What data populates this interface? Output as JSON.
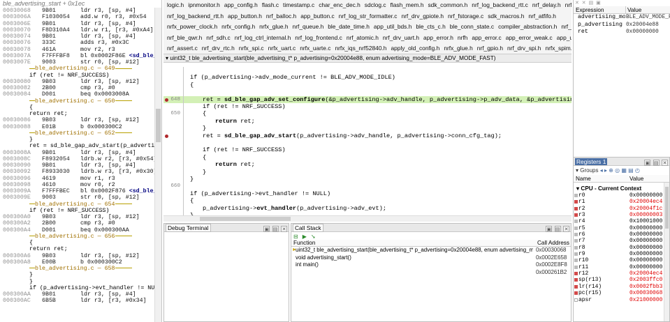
{
  "disassembly": {
    "header": "ble_advertising_start + 0x1ec",
    "lines": [
      {
        "kind": "asm",
        "addr": "00030068",
        "op": "9B01",
        "ins": "ldr r3, [sp, #4]"
      },
      {
        "kind": "asm",
        "addr": "0003006A",
        "op": "F1030054",
        "ins": "add.w r0, r3, #0x54"
      },
      {
        "kind": "asm",
        "addr": "0003006E",
        "op": "9B01",
        "ins": "ldr r3, [sp, #4]"
      },
      {
        "kind": "asm",
        "addr": "00030070",
        "op": "F8D310A4",
        "ins": "ldr.w r1, [r3, #0xA4]"
      },
      {
        "kind": "asm",
        "addr": "00030074",
        "op": "9B01",
        "ins": "ldr r3, [sp, #4]"
      },
      {
        "kind": "asm",
        "addr": "00030076",
        "op": "333C",
        "ins": "adds r3, #0x3C"
      },
      {
        "kind": "asm",
        "addr": "00030078",
        "op": "461A",
        "ins": "mov r2, r3"
      },
      {
        "kind": "asm",
        "addr": "0003007A",
        "op": "F7FFFBF8",
        "ins": "bl 0x0002F86E ",
        "sym": "<sd_ble_gap"
      },
      {
        "kind": "asm",
        "addr": "0003007E",
        "op": "9003",
        "ins": "str r0, [sp, #12]"
      },
      {
        "kind": "hdr",
        "text": "ble_advertising.c — 649"
      },
      {
        "kind": "src",
        "text": "if (ret != NRF_SUCCESS)"
      },
      {
        "kind": "asm",
        "addr": "00030080",
        "op": "9B03",
        "ins": "ldr r3, [sp, #12]"
      },
      {
        "kind": "asm",
        "addr": "00030082",
        "op": "2B00",
        "ins": "cmp r3, #0"
      },
      {
        "kind": "asm",
        "addr": "00030084",
        "op": "D001",
        "ins": "beq 0x0003008A"
      },
      {
        "kind": "hdr",
        "text": "ble_advertising.c — 650"
      },
      {
        "kind": "src",
        "text": "{"
      },
      {
        "kind": "src",
        "text": "return ret;"
      },
      {
        "kind": "asm",
        "addr": "00030086",
        "op": "9B03",
        "ins": "ldr r3, [sp, #12]"
      },
      {
        "kind": "asm",
        "addr": "00030088",
        "op": "E01B",
        "ins": "b 0x000300C2"
      },
      {
        "kind": "hdr",
        "text": "ble_advertising.c — 652"
      },
      {
        "kind": "src",
        "text": "}"
      },
      {
        "kind": "src",
        "text": "ret = sd_ble_gap_adv_start(p_advertising"
      },
      {
        "kind": "asm",
        "addr": "0003008A",
        "op": "9B01",
        "ins": "ldr r3, [sp, #4]"
      },
      {
        "kind": "asm",
        "addr": "0003008C",
        "op": "F8932054",
        "ins": "ldrb.w r2, [r3, #0x54]"
      },
      {
        "kind": "asm",
        "addr": "00030090",
        "op": "9B01",
        "ins": "ldr r3, [sp, #4]"
      },
      {
        "kind": "asm",
        "addr": "00030092",
        "op": "F8933030",
        "ins": "ldrb.w r3, [r3, #0x30]"
      },
      {
        "kind": "asm",
        "addr": "00030096",
        "op": "4619",
        "ins": "mov r1, r3"
      },
      {
        "kind": "asm",
        "addr": "00030098",
        "op": "4610",
        "ins": "mov r0, r2"
      },
      {
        "kind": "asm",
        "addr": "0003009A",
        "op": "F7FFFBEC",
        "ins": "bl 0x0002F876 ",
        "sym": "<sd_ble_ga"
      },
      {
        "kind": "asm",
        "addr": "0003009E",
        "op": "9003",
        "ins": "str r0, [sp, #12]"
      },
      {
        "kind": "hdr",
        "text": "ble_advertising.c — 654"
      },
      {
        "kind": "src",
        "text": "if (ret != NRF_SUCCESS)"
      },
      {
        "kind": "asm",
        "addr": "000300A0",
        "op": "9B03",
        "ins": "ldr r3, [sp, #12]"
      },
      {
        "kind": "asm",
        "addr": "000300A2",
        "op": "2B00",
        "ins": "cmp r3, #0"
      },
      {
        "kind": "asm",
        "addr": "000300A4",
        "op": "D001",
        "ins": "beq 0x000300AA"
      },
      {
        "kind": "hdr",
        "text": "ble_advertising.c — 656"
      },
      {
        "kind": "src",
        "text": "{"
      },
      {
        "kind": "src",
        "text": "return ret;"
      },
      {
        "kind": "asm",
        "addr": "000300A6",
        "op": "9B03",
        "ins": "ldr r3, [sp, #12]"
      },
      {
        "kind": "asm",
        "addr": "000300A8",
        "op": "E00B",
        "ins": "b 0x000300C2"
      },
      {
        "kind": "hdr",
        "text": "ble_advertising.c — 658"
      },
      {
        "kind": "src",
        "text": "}"
      },
      {
        "kind": "src",
        "text": "}"
      },
      {
        "kind": "src",
        "text": "if (p_advertising->evt_handler != NULL)"
      },
      {
        "kind": "asm",
        "addr": "000300AA",
        "op": "9B01",
        "ins": "ldr r3, [sp, #4]"
      },
      {
        "kind": "asm",
        "addr": "000300AC",
        "op": "6B5B",
        "ins": "ldr r3, [r3, #0x34]"
      }
    ]
  },
  "tabs": {
    "rows": [
      [
        "logic.h",
        "ipnmonitor.h",
        "app_config.h",
        "flash.c",
        "timestamp.c",
        "char_enc_dec.h",
        "sdclog.c",
        "flash_mem.h",
        "sdk_common.h",
        "nrf_log_backend_rtt.c",
        "nrf_delay.h",
        "nrfx.h"
      ],
      [
        "nrf_log_backend_rtt.h",
        "app_button.h",
        "nrf_balloc.h",
        "app_button.c",
        "nrf_log_str_formatter.c",
        "nrf_drv_gpiote.h",
        "nrf_fstorage.c",
        "sdk_macros.h",
        "nrf_atfifo.h"
      ],
      [
        "nrfx_power_clock.h",
        "nrfx_config.h",
        "nrfx_glue.h",
        "nrf_queue.h",
        "ble_date_time.h",
        "app_util_bds.h",
        "ble_cts_c.h",
        "ble_conn_state.c",
        "compiler_abstraction.h",
        "nrf_ble_gatt.c"
      ],
      [
        "nrf_ble_qwr.h",
        "nrf_sdh.c",
        "nrf_log_ctrl_internal.h",
        "nrf_log_frontend.c",
        "nrf_atomic.h",
        "nrf_drv_uart.h",
        "app_error.h",
        "nrfh",
        "app_error.c",
        "app_error_weak.c",
        "app_util_platform.c"
      ],
      [
        "nrf_assert.c",
        "nrf_drv_rtc.h",
        "nrfx_spi.c",
        "nrfx_uart.c",
        "nrfx_uarte.c",
        "nrfx_iqs_nrf52840.h",
        "apply_old_config.h",
        "nrfx_glue.h",
        "nrf_gpio.h",
        "nrf_drv_spi.h",
        "nrfx_spim.h",
        "nrfx_spi.h"
      ],
      [
        "nrfx_spim.c",
        "flash_mem.c",
        "timestamp.h",
        "nrf_serial.h",
        "ble_advertising.c",
        "ble_advertising.h",
        "app_error_handler_gcc.c",
        "ble_gap.h"
      ]
    ],
    "active": "ble_advertising.c"
  },
  "editor": {
    "function_signature": "uint32_t ble_advertising_start(ble_advertising_t* p_advertising=0x20004e88, enum advertising_mode=BLE_ADV_MODE_FAST)",
    "lines": [
      {
        "ln": "",
        "bp": false,
        "hl": false,
        "indent": 0,
        "code": ""
      },
      {
        "ln": "",
        "bp": false,
        "hl": false,
        "indent": 0,
        "code": "if (p_advertising->adv_mode_current != BLE_ADV_MODE_IDLE)"
      },
      {
        "ln": "",
        "bp": false,
        "hl": false,
        "indent": 0,
        "code": "{"
      },
      {
        "ln": "",
        "bp": false,
        "hl": false,
        "indent": 0,
        "code": ""
      },
      {
        "ln": "648",
        "bp": true,
        "hl": true,
        "indent": 1,
        "pre": "ret = ",
        "fn": "sd_ble_gap_adv_set_configure",
        "post": "(&p_advertising->adv_handle, p_advertising->p_adv_data, &p_advertising->adv_para"
      },
      {
        "ln": "",
        "bp": false,
        "hl": false,
        "indent": 1,
        "code": "if (ret != NRF_SUCCESS)"
      },
      {
        "ln": "650",
        "bp": false,
        "hl": false,
        "indent": 1,
        "code": "{"
      },
      {
        "ln": "",
        "bp": false,
        "hl": false,
        "indent": 2,
        "pre": "",
        "fn": "return",
        "post": " ret;"
      },
      {
        "ln": "",
        "bp": false,
        "hl": false,
        "indent": 1,
        "code": "}"
      },
      {
        "ln": "",
        "bp": true,
        "hl": false,
        "indent": 1,
        "pre": "ret = ",
        "fn": "sd_ble_gap_adv_start",
        "post": "(p_advertising->adv_handle, p_advertising->conn_cfg_tag);"
      },
      {
        "ln": "",
        "bp": false,
        "hl": false,
        "indent": 0,
        "code": ""
      },
      {
        "ln": "",
        "bp": false,
        "hl": false,
        "indent": 1,
        "code": "if (ret != NRF_SUCCESS)"
      },
      {
        "ln": "",
        "bp": false,
        "hl": false,
        "indent": 1,
        "code": "{"
      },
      {
        "ln": "",
        "bp": false,
        "hl": false,
        "indent": 2,
        "pre": "",
        "fn": "return",
        "post": " ret;"
      },
      {
        "ln": "",
        "bp": false,
        "hl": false,
        "indent": 1,
        "code": "}"
      },
      {
        "ln": "",
        "bp": false,
        "hl": false,
        "indent": 0,
        "code": "}"
      },
      {
        "ln": "660",
        "bp": false,
        "hl": false,
        "indent": 0,
        "code": ""
      },
      {
        "ln": "",
        "bp": false,
        "hl": false,
        "indent": 0,
        "code": "if (p_advertising->evt_handler != NULL)"
      },
      {
        "ln": "",
        "bp": false,
        "hl": false,
        "indent": 0,
        "code": "{"
      },
      {
        "ln": "",
        "bp": false,
        "hl": false,
        "indent": 1,
        "pre": "p_advertising->",
        "fn": "evt_handler",
        "post": "(p_advertising->adv_evt);"
      },
      {
        "ln": "",
        "bp": false,
        "hl": false,
        "indent": 0,
        "code": "}"
      }
    ]
  },
  "debug_terminal": {
    "title": "Debug Terminal"
  },
  "call_stack": {
    "title": "Call Stack",
    "col_function": "Function",
    "col_address": "Call Address",
    "rows": [
      {
        "fn": "uint32_t ble_advertising_start(ble_advertising_t* p_advertising=0x20004e88, enum advertising_mode=BL",
        "addr": "0x00030068",
        "current": true
      },
      {
        "fn": "void advertising_start()",
        "addr": "0x0002E658",
        "current": false
      },
      {
        "fn": "int main()",
        "addr": "0x0002E8F8",
        "current": false
      },
      {
        "fn": "",
        "addr": "0x000261B2",
        "current": false
      }
    ]
  },
  "watch": {
    "col_expression": "Expression",
    "col_value": "Value",
    "rows": [
      {
        "name": "advertising_mode",
        "value": "BLE_ADV_MODE_FAST"
      },
      {
        "name": "p_advertising",
        "value": "0x20004e88"
      },
      {
        "name": "ret",
        "value": "0x00000000"
      }
    ]
  },
  "registers": {
    "title": "Registers 1",
    "groups_label": "Groups",
    "col_name": "Name",
    "col_value": "Value",
    "group": "CPU - Current Context",
    "rows": [
      {
        "name": "r0",
        "value": "0x00000000",
        "changed": false,
        "plus": false
      },
      {
        "name": "r1",
        "value": "0x20004ec4",
        "changed": true,
        "plus": false
      },
      {
        "name": "r2",
        "value": "0x20004f1c",
        "changed": true,
        "plus": false
      },
      {
        "name": "r3",
        "value": "0x00000003",
        "changed": true,
        "plus": false
      },
      {
        "name": "r4",
        "value": "0x10001000",
        "changed": false,
        "plus": false
      },
      {
        "name": "r5",
        "value": "0x00000000",
        "changed": false,
        "plus": false
      },
      {
        "name": "r6",
        "value": "0x00000000",
        "changed": false,
        "plus": false
      },
      {
        "name": "r7",
        "value": "0x00000000",
        "changed": false,
        "plus": false
      },
      {
        "name": "r8",
        "value": "0x00000000",
        "changed": false,
        "plus": false
      },
      {
        "name": "r9",
        "value": "0x00000000",
        "changed": false,
        "plus": false
      },
      {
        "name": "r10",
        "value": "0x00000000",
        "changed": false,
        "plus": false
      },
      {
        "name": "r11",
        "value": "0x00000000",
        "changed": false,
        "plus": false
      },
      {
        "name": "r12",
        "value": "0x20004ec4",
        "changed": true,
        "plus": false
      },
      {
        "name": "sp(r13)",
        "value": "0x2003ffc0",
        "changed": true,
        "plus": false
      },
      {
        "name": "lr(r14)",
        "value": "0x0002fbb3",
        "changed": true,
        "plus": false
      },
      {
        "name": "pc(r15)",
        "value": "0x00030068",
        "changed": true,
        "plus": false
      },
      {
        "name": "apsr",
        "value": "0x21000000",
        "changed": true,
        "plus": true
      }
    ]
  }
}
